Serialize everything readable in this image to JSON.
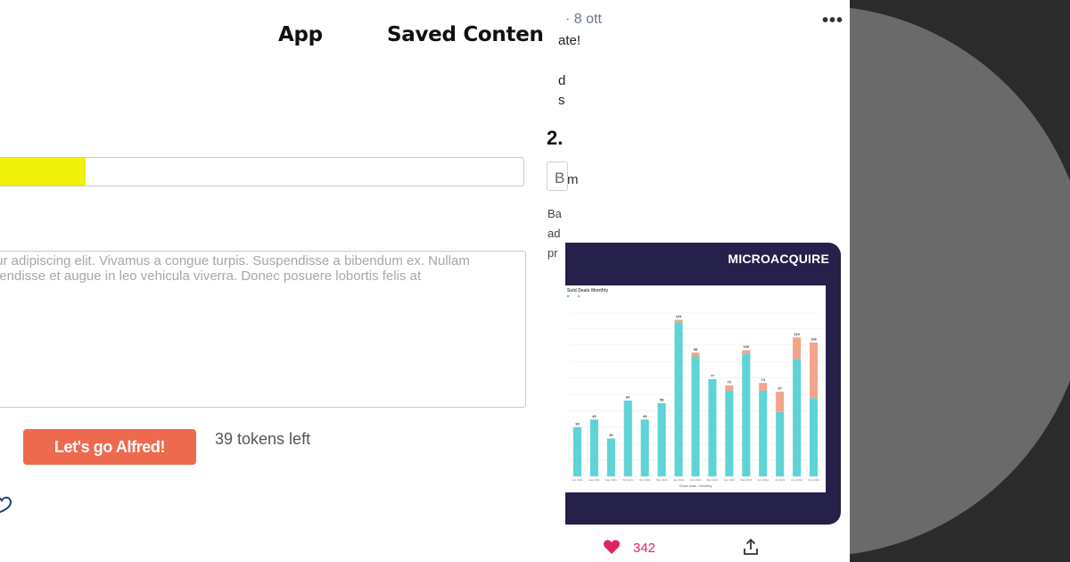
{
  "app": {
    "nav": {
      "app_label": "App",
      "saved_label": "Saved Content"
    },
    "title_input": {
      "value": ""
    },
    "prompt": {
      "value": "tur adipiscing elit. Vivamus a congue turpis. Suspendisse a bibendum ex. Nullam\npendisse et augue in leo vehicula viverra. Donec posuere lobortis felis at"
    },
    "go_button_label": "Let's go Alfred!",
    "tokens_left": "39 tokens left",
    "accent_color": "#ee6a4f",
    "highlight_color": "#f1f20a"
  },
  "tweet": {
    "date": "· 8 ott",
    "more_icon": "more-horizontal-icon",
    "lines": [
      "ate!",
      "d",
      "s"
    ],
    "heading": "2.",
    "box_letter": "B",
    "box_letter_after": "m",
    "para_lines": [
      "Ba",
      "ad",
      "pr"
    ],
    "image": {
      "brand": "MICROACQUIRE",
      "chart_title": "Sold Deals Monthly",
      "xlabel": "Close date - Monthly"
    },
    "likes": "342",
    "like_color": "#e0245e"
  },
  "chart_data": {
    "type": "bar",
    "title": "Sold Deals Monthly",
    "xlabel": "Close date - Monthly",
    "ylabel": "",
    "stacked": true,
    "categories": [
      "Jun 2021",
      "Aug 2021",
      "Sep 2021",
      "Oct 2021",
      "Nov 2021",
      "Dec 2021",
      "Jan 2022",
      "Feb 2022",
      "Mar 2022",
      "Apr 2022",
      "May 2022",
      "Jun 2022",
      "Jul 2022",
      "Aug 2022",
      "Sep 2022"
    ],
    "series": [
      {
        "name": "",
        "color": "#5fd3d6",
        "values": [
          39,
          45,
          30,
          60,
          45,
          58,
          122,
          95,
          77,
          68,
          97,
          68,
          51,
          93,
          62
        ]
      },
      {
        "name": "",
        "color": "#f4a48a",
        "values": [
          0,
          0,
          0,
          0,
          0,
          0,
          2,
          3,
          0,
          4,
          3,
          6,
          16,
          17,
          44
        ]
      }
    ],
    "data_labels": [
      "39",
      "45",
      "30",
      "60",
      "45",
      "58",
      "124",
      "98",
      "77",
      "72",
      "100",
      "74",
      "67",
      "110",
      "106"
    ],
    "ylim": [
      0,
      130
    ],
    "grid": true
  }
}
